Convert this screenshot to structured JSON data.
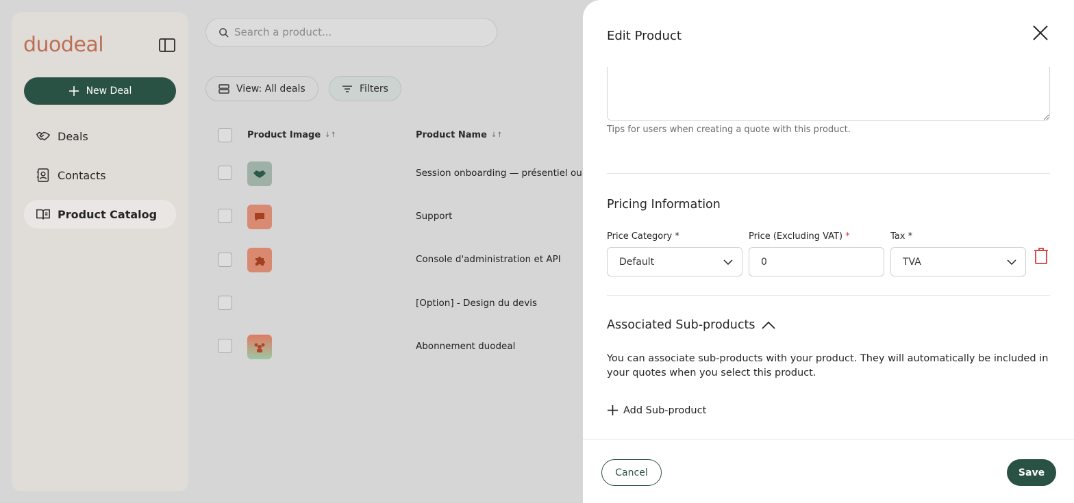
{
  "brand": {
    "logo_text": "duodeal",
    "logo_color": "#bd6f55",
    "accent": "#2a5244"
  },
  "sidebar": {
    "new_deal_label": "New Deal",
    "items": [
      {
        "label": "Deals",
        "icon": "handshake-icon",
        "active": false
      },
      {
        "label": "Contacts",
        "icon": "contact-card-icon",
        "active": false
      },
      {
        "label": "Product Catalog",
        "icon": "book-open-icon",
        "active": true
      }
    ]
  },
  "search": {
    "placeholder": "Search a product..."
  },
  "toolbar": {
    "view_label": "View: All deals",
    "filters_label": "Filters"
  },
  "table": {
    "columns": [
      "Product Image",
      "Product Name"
    ],
    "rows": [
      {
        "name": "Session onboarding — présentiel ou v",
        "image": "handshake-thumbnail",
        "image_color": "#9fb0a6"
      },
      {
        "name": "Support",
        "image": "chat-thumbnail",
        "image_color": "#d98a72"
      },
      {
        "name": "Console d'administration et API",
        "image": "puzzle-thumbnail",
        "image_color": "#d8896f"
      },
      {
        "name": "[Option] - Design du devis",
        "image": "",
        "image_color": ""
      },
      {
        "name": "Abonnement duodeal",
        "image": "team-thumbnail",
        "image_color": "#d98a72"
      }
    ]
  },
  "drawer": {
    "title": "Edit Product",
    "notes_hint": "Tips for users when creating a quote with this product.",
    "pricing": {
      "title": "Pricing Information",
      "price_category_label": "Price Category",
      "price_category_value": "Default",
      "price_label": "Price (Excluding VAT)",
      "price_value": "0",
      "tax_label": "Tax",
      "tax_value": "TVA"
    },
    "subproducts": {
      "title": "Associated Sub-products",
      "description": "You can associate sub-products with your product. They will automatically be included in your quotes when you select this product.",
      "add_label": "Add Sub-product"
    },
    "footer": {
      "cancel_label": "Cancel",
      "save_label": "Save"
    }
  }
}
